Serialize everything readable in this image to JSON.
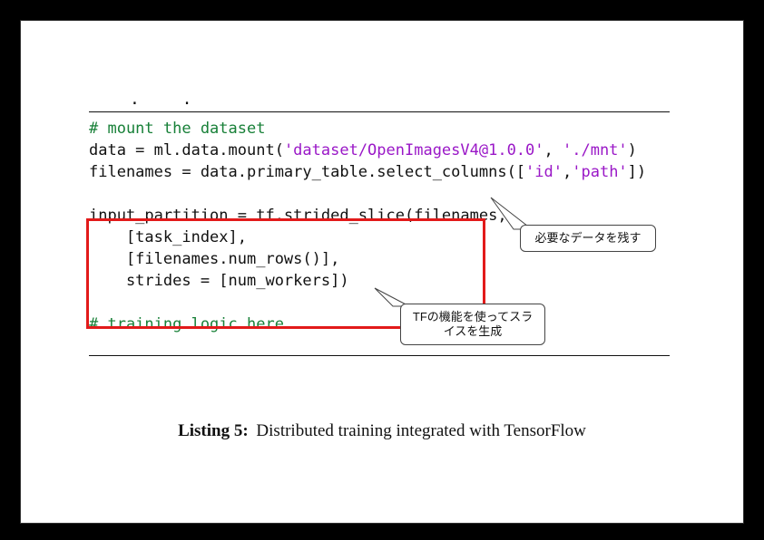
{
  "above_dots": ". .",
  "code": {
    "l1_comment": "# mount the dataset",
    "l2a": "data = ml.data.mount(",
    "l2s1": "'dataset/OpenImagesV4@1.0.0'",
    "l2b": ", ",
    "l2s2": "'./mnt'",
    "l2c": ")",
    "l3a": "filenames = data.primary_table.select_columns([",
    "l3s1": "'id'",
    "l3b": ",",
    "l3s2": "'path'",
    "l3c": "])",
    "blank": "",
    "l4": "input_partition = tf.strided_slice(filenames,",
    "l5": "    [task_index],",
    "l6": "    [filenames.num_rows()],",
    "l7": "    strides = [num_workers])",
    "l8_comment": "# training logic here ..."
  },
  "callout1": "必要なデータを残す",
  "callout2a": "TFの機能を使ってスラ",
  "callout2b": "イスを生成",
  "caption_label": "Listing 5:",
  "caption_text": " Distributed training integrated with TensorFlow"
}
